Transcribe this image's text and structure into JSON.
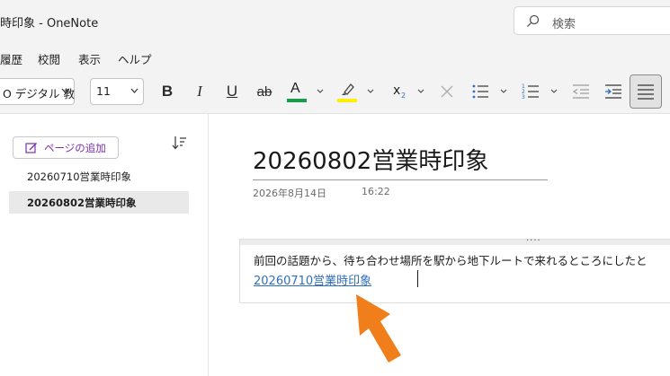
{
  "window": {
    "title": "時印象  -  OneNote"
  },
  "search": {
    "placeholder": "検索"
  },
  "menu": {
    "items": [
      "履歴",
      "校閲",
      "表示",
      "ヘルプ"
    ]
  },
  "ribbon": {
    "font_name": "O デジタル 教",
    "font_size": "11",
    "bold": "B",
    "italic": "I",
    "underline": "U",
    "strikethrough": "ab",
    "font_color_letter": "A",
    "subscript": "x",
    "subscript_index": "2",
    "colors": {
      "font_color": "#1a9a4a",
      "highlight": "#ffee00"
    }
  },
  "sidebar": {
    "add_page_label": "ページの追加",
    "pages": [
      {
        "label": "20260710営業時印象",
        "selected": false
      },
      {
        "label": "20260802営業時印象",
        "selected": true
      }
    ]
  },
  "page": {
    "title": "20260802営業時印象",
    "date": "2026年8月14日",
    "time": "16:22",
    "body_text": "前回の話題から、待ち合わせ場所を駅から地下ルートで来れるところにしたと",
    "link_text": "20260710営業時印象",
    "handle": "····"
  },
  "accent": {
    "arrow": "#f07e1a",
    "link": "#2f6fc0",
    "add_page": "#7b2fa8"
  }
}
